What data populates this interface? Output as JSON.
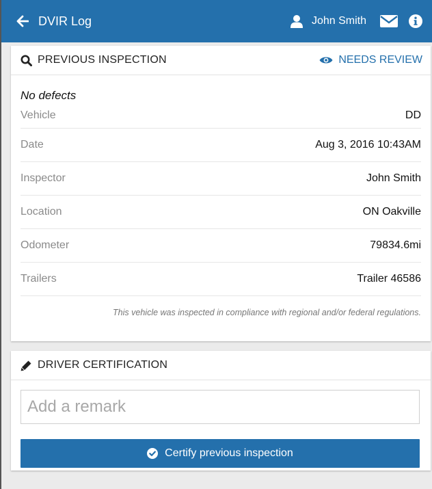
{
  "colors": {
    "primary": "#2470ac",
    "background": "#ebebeb"
  },
  "topbar": {
    "back_icon": "arrow-left-icon",
    "title": "DVIR Log",
    "user_icon": "user-icon",
    "user_name": "John Smith",
    "mail_icon": "envelope-icon",
    "info_icon": "info-circle-icon"
  },
  "previous_inspection": {
    "header_icon": "search-icon",
    "title": "PREVIOUS INSPECTION",
    "status_icon": "eye-icon",
    "status": "NEEDS REVIEW",
    "defects": "No defects",
    "fields": [
      {
        "label": "Vehicle",
        "value": "DD"
      },
      {
        "label": "Date",
        "value": "Aug 3, 2016 10:43AM"
      },
      {
        "label": "Inspector",
        "value": "John Smith"
      },
      {
        "label": "Location",
        "value": "ON Oakville"
      },
      {
        "label": "Odometer",
        "value": "79834.6mi"
      },
      {
        "label": "Trailers",
        "value": "Trailer 46586"
      }
    ],
    "compliance_note": "This vehicle was inspected in compliance with regional and/or federal regulations."
  },
  "driver_certification": {
    "header_icon": "pencil-icon",
    "title": "DRIVER CERTIFICATION",
    "remark_value": "",
    "remark_placeholder": "Add a remark",
    "certify_icon": "check-circle-icon",
    "certify_label": "Certify previous inspection"
  }
}
